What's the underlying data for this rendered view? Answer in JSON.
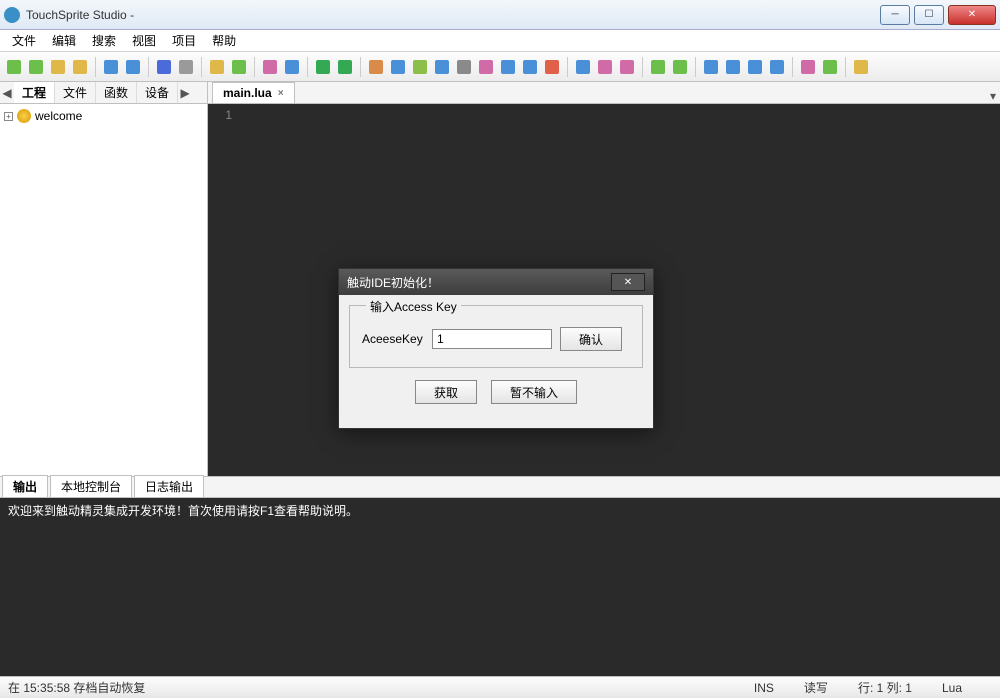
{
  "window": {
    "title": "TouchSprite Studio -",
    "min": "─",
    "max": "☐",
    "close": "✕"
  },
  "menu": [
    "文件",
    "编辑",
    "搜索",
    "视图",
    "项目",
    "帮助"
  ],
  "side_tabs": {
    "nav_left": "◀",
    "nav_right": "▶",
    "items": [
      "工程",
      "文件",
      "函数",
      "设备"
    ]
  },
  "tree": {
    "expand": "+",
    "root": "welcome"
  },
  "file_tab": {
    "name": "main.lua",
    "close": "×"
  },
  "editor": {
    "line1": "1"
  },
  "bottom_tabs": [
    "输出",
    "本地控制台",
    "日志输出"
  ],
  "output_text": "欢迎来到触动精灵集成开发环境！首次使用请按F1查看帮助说明。",
  "statusbar": {
    "left": "在 15:35:58 存档自动恢复",
    "ins": "INS",
    "rw": "读写",
    "pos": "行: 1 列: 1",
    "lang": "Lua"
  },
  "dialog": {
    "title": "触动IDE初始化！",
    "close": "✕",
    "group_label": "输入Access Key",
    "field_label": "AceeseKey",
    "field_value": "1",
    "btn_confirm": "确认",
    "btn_get": "获取",
    "btn_skip": "暂不输入"
  },
  "toolbar_colors": [
    "#6bbf4a",
    "#6bbf4a",
    "#e0b84a",
    "#e0b84a",
    "",
    "#4a90d9",
    "#4a90d9",
    "",
    "#4a6bd9",
    "#9a9a9a",
    "",
    "#e0b84a",
    "#6bbf4a",
    "",
    "#d06ba8",
    "#4a90d9",
    "",
    "#34a853",
    "#34a853",
    "",
    "#d98b4a",
    "#4a90d9",
    "#8bbf4a",
    "#4a90d9",
    "#8a8a8a",
    "#d06ba8",
    "#4a90d9",
    "#4a90d9",
    "#e0604a",
    "",
    "#4a90d9",
    "#d06ba8",
    "#d06ba8",
    "",
    "#6bbf4a",
    "#6bbf4a",
    "",
    "#4a90d9",
    "#4a90d9",
    "#4a90d9",
    "#4a90d9",
    "",
    "#d06ba8",
    "#6bbf4a",
    "",
    "#e0b84a"
  ]
}
